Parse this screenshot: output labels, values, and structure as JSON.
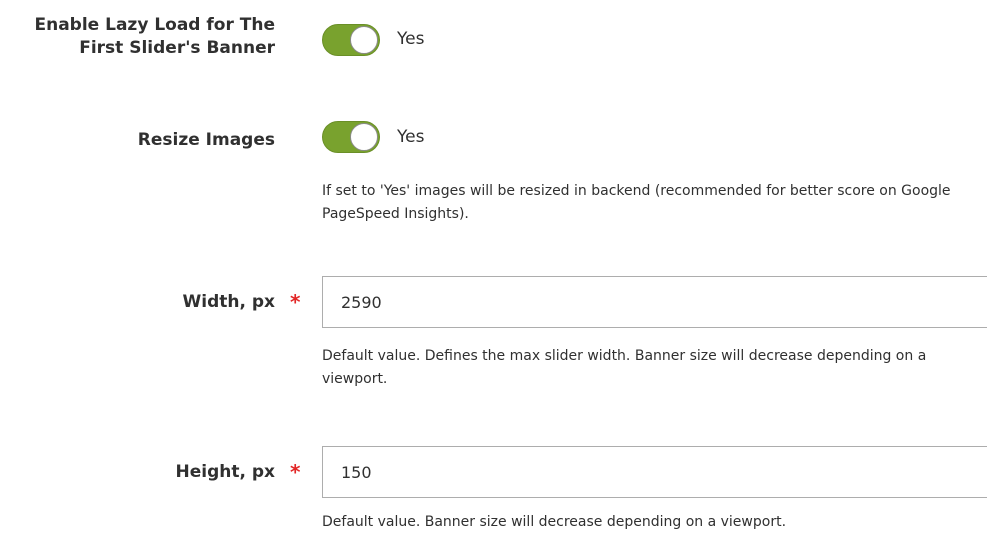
{
  "fields": {
    "lazy_load": {
      "label_line1": "Enable Lazy Load for The",
      "label_line2": "First Slider's Banner",
      "state": "on",
      "value_text": "Yes"
    },
    "resize_images": {
      "label": "Resize Images",
      "state": "on",
      "value_text": "Yes",
      "note": "If set to 'Yes' images will be resized in backend (recommended for better score on Google PageSpeed Insights)."
    },
    "width": {
      "label": "Width, px",
      "required_mark": "*",
      "value": "2590",
      "note": "Default value. Defines the max slider width. Banner size will decrease depending on a viewport."
    },
    "height": {
      "label": "Height, px",
      "required_mark": "*",
      "value": "150",
      "note": "Default value. Banner size will decrease depending on a viewport."
    }
  },
  "colors": {
    "toggle_on": "#79a22e",
    "required": "#e22626",
    "text": "#303030",
    "input_border": "#adadad"
  },
  "icons": {
    "toggle": "toggle-switch-icon"
  }
}
